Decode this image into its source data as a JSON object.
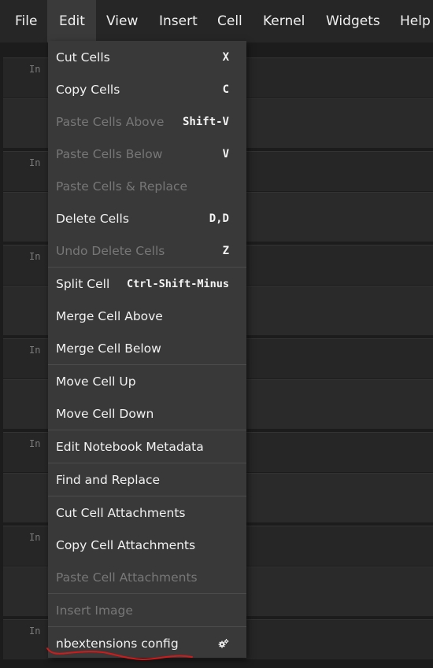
{
  "menubar": {
    "items": [
      "File",
      "Edit",
      "View",
      "Insert",
      "Cell",
      "Kernel",
      "Widgets",
      "Help"
    ],
    "active": "Edit"
  },
  "prompt_label": "In [",
  "edit_menu": {
    "items": [
      {
        "label": "Cut Cells",
        "shortcut": "X",
        "enabled": true
      },
      {
        "label": "Copy Cells",
        "shortcut": "C",
        "enabled": true
      },
      {
        "label": "Paste Cells Above",
        "shortcut": "Shift-V",
        "enabled": false
      },
      {
        "label": "Paste Cells Below",
        "shortcut": "V",
        "enabled": false
      },
      {
        "label": "Paste Cells & Replace",
        "shortcut": "",
        "enabled": false
      },
      {
        "label": "Delete Cells",
        "shortcut": "D,D",
        "enabled": true
      },
      {
        "label": "Undo Delete Cells",
        "shortcut": "Z",
        "enabled": false
      },
      {
        "label": "Split Cell",
        "shortcut": "Ctrl-Shift-Minus",
        "enabled": true
      },
      {
        "label": "Merge Cell Above",
        "shortcut": "",
        "enabled": true
      },
      {
        "label": "Merge Cell Below",
        "shortcut": "",
        "enabled": true
      },
      {
        "label": "Move Cell Up",
        "shortcut": "",
        "enabled": true
      },
      {
        "label": "Move Cell Down",
        "shortcut": "",
        "enabled": true
      },
      {
        "label": "Edit Notebook Metadata",
        "shortcut": "",
        "enabled": true
      },
      {
        "label": "Find and Replace",
        "shortcut": "",
        "enabled": true
      },
      {
        "label": "Cut Cell Attachments",
        "shortcut": "",
        "enabled": true
      },
      {
        "label": "Copy Cell Attachments",
        "shortcut": "",
        "enabled": true
      },
      {
        "label": "Paste Cell Attachments",
        "shortcut": "",
        "enabled": false
      },
      {
        "label": "Insert Image",
        "shortcut": "",
        "enabled": false
      },
      {
        "label": "nbextensions config",
        "shortcut": "",
        "enabled": true,
        "icon": "gears-icon"
      }
    ]
  },
  "colors": {
    "menubar_bg": "#262626",
    "menu_bg": "#393939",
    "text": "#f2f2f2",
    "disabled_text": "#777777",
    "annotation": "#d21a1a"
  }
}
